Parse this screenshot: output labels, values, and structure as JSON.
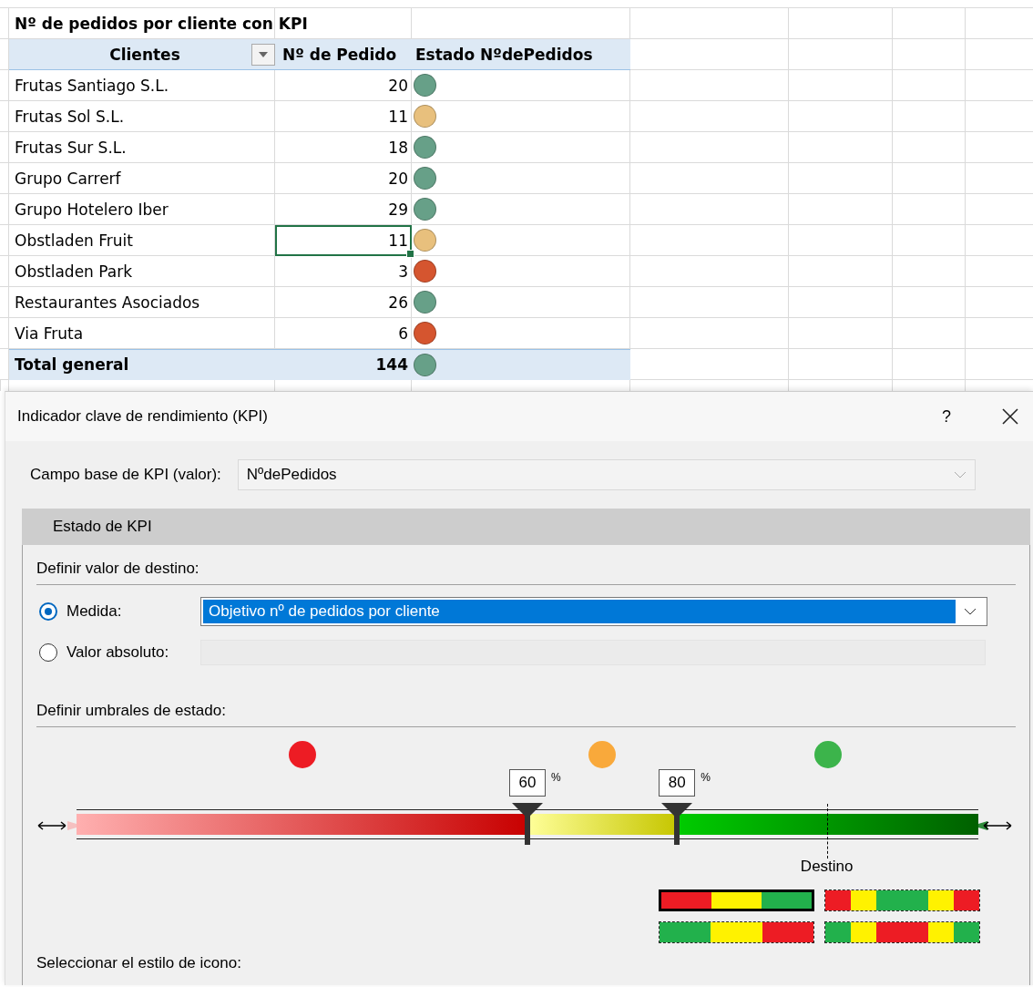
{
  "sheet": {
    "title": "Nº de pedidos por cliente con KPI",
    "columns": [
      "Clientes",
      "Nº de Pedido",
      "Estado NºdePedidos"
    ],
    "rows": [
      {
        "client": "Frutas Santiago S.L.",
        "orders": "20",
        "color": "#67a088",
        "selected": false
      },
      {
        "client": "Frutas Sol S.L.",
        "orders": "11",
        "color": "#e8c07d",
        "selected": false
      },
      {
        "client": "Frutas Sur S.L.",
        "orders": "18",
        "color": "#67a088",
        "selected": false
      },
      {
        "client": "Grupo Carrerf",
        "orders": "20",
        "color": "#67a088",
        "selected": false
      },
      {
        "client": "Grupo Hotelero Iber",
        "orders": "29",
        "color": "#67a088",
        "selected": false
      },
      {
        "client": "Obstladen Fruit",
        "orders": "11",
        "color": "#e8c07d",
        "selected": true
      },
      {
        "client": "Obstladen Park",
        "orders": "3",
        "color": "#d5552f",
        "selected": false
      },
      {
        "client": "Restaurantes Asociados",
        "orders": "26",
        "color": "#67a088",
        "selected": false
      },
      {
        "client": "Via Fruta",
        "orders": "6",
        "color": "#d5552f",
        "selected": false
      }
    ],
    "total": {
      "label": "Total general",
      "orders": "144",
      "color": "#67a088"
    }
  },
  "dialog": {
    "title": "Indicador clave de rendimiento (KPI)",
    "help": "?",
    "base_field": {
      "label": "Campo base de KPI (valor):",
      "value": "NºdePedidos"
    },
    "section_tab": "Estado de KPI",
    "target": {
      "heading": "Definir valor de destino:",
      "options": [
        {
          "label": "Medida:",
          "selected": true,
          "value": "Objetivo nº de pedidos por cliente"
        },
        {
          "label": "Valor absoluto:",
          "selected": false
        }
      ]
    },
    "thresholds_heading": "Definir umbrales de estado:",
    "zones": [
      {
        "color": "#ed1c24"
      },
      {
        "color": "#f9a93b"
      },
      {
        "color": "#3cb44b"
      }
    ],
    "thresholds": [
      {
        "value": "60",
        "unit": "%",
        "level": 0.5
      },
      {
        "value": "80",
        "unit": "%",
        "level": 0.666
      }
    ],
    "target_marker": {
      "label": "Destino",
      "level": 0.832
    },
    "patterns": [
      {
        "selected": true,
        "segments": [
          {
            "color": "#ed1c24"
          },
          {
            "color": "#fff200"
          },
          {
            "color": "#22b14c"
          }
        ]
      },
      {
        "selected": false,
        "segments": [
          {
            "color": "#ed1c24"
          },
          {
            "color": "#fff200"
          },
          {
            "color": "#22b14c"
          },
          {
            "color": "#22b14c"
          },
          {
            "color": "#fff200"
          },
          {
            "color": "#ed1c24"
          }
        ]
      },
      {
        "selected": false,
        "segments": [
          {
            "color": "#22b14c"
          },
          {
            "color": "#fff200"
          },
          {
            "color": "#ed1c24"
          }
        ]
      },
      {
        "selected": false,
        "segments": [
          {
            "color": "#22b14c"
          },
          {
            "color": "#fff200"
          },
          {
            "color": "#ed1c24"
          },
          {
            "color": "#ed1c24"
          },
          {
            "color": "#fff200"
          },
          {
            "color": "#22b14c"
          }
        ]
      }
    ],
    "icon_style_heading": "Seleccionar el estilo de icono:"
  }
}
